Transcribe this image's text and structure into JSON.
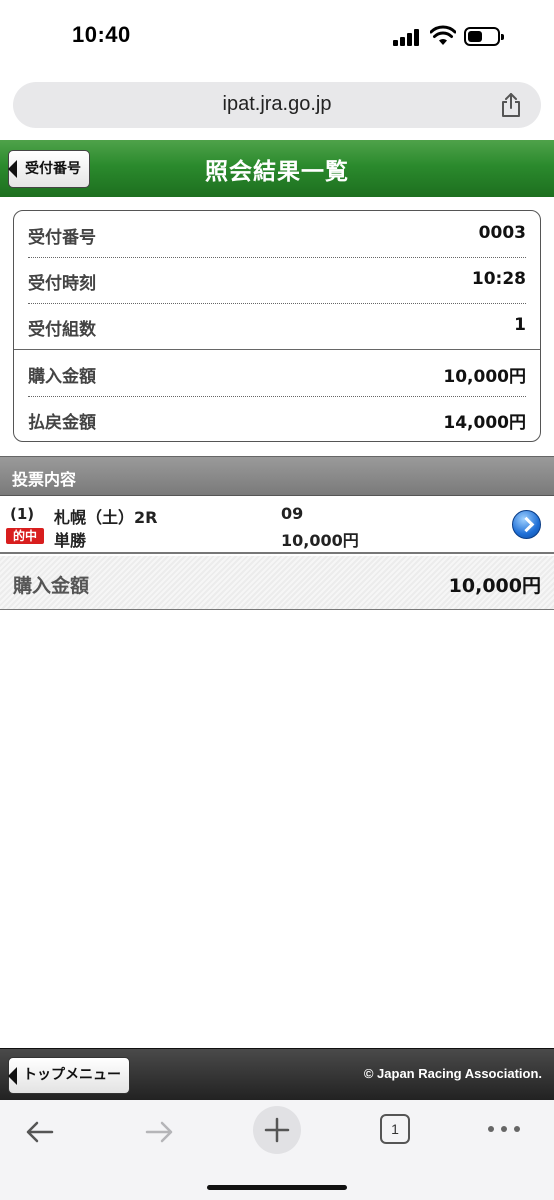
{
  "status_bar": {
    "time": "10:40"
  },
  "browser": {
    "url": "ipat.jra.go.jp",
    "tab_count": "1"
  },
  "header": {
    "back_label": "受付番号",
    "title": "照会結果一覧"
  },
  "receipt": {
    "rows": [
      {
        "label": "受付番号",
        "value": "0003"
      },
      {
        "label": "受付時刻",
        "value": "10:28"
      },
      {
        "label": "受付組数",
        "value": "1"
      },
      {
        "label": "購入金額",
        "value": "10,000円"
      },
      {
        "label": "払戻金額",
        "value": "14,000円"
      }
    ]
  },
  "bets_section": {
    "title": "投票内容",
    "items": [
      {
        "index": "(1)",
        "race": "札幌（土）2R",
        "selection": "09",
        "result_badge": "的中",
        "bet_type": "単勝",
        "amount": "10,000円"
      }
    ]
  },
  "total": {
    "label": "購入金額",
    "value": "10,000円"
  },
  "footer": {
    "menu_label": "トップメニュー",
    "copyright": "© Japan Racing Association."
  },
  "colors": {
    "header_green": "#2b8a2d",
    "hit_red": "#d81e1e",
    "link_blue": "#1f6fd6"
  },
  "icons": [
    "signal-icon",
    "wifi-icon",
    "battery-icon",
    "share-icon",
    "chevron-right-icon",
    "back-arrow-icon",
    "forward-arrow-icon",
    "plus-icon",
    "tabs-icon",
    "more-icon"
  ]
}
